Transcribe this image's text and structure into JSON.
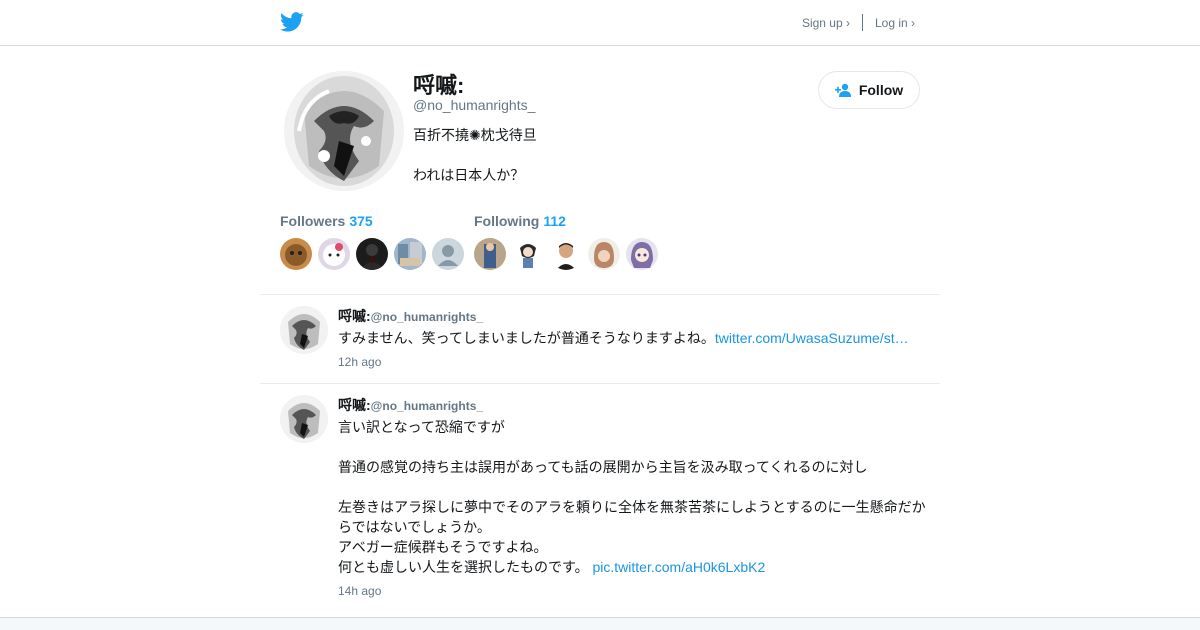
{
  "header": {
    "sign_up_label": "Sign up ›",
    "log_in_label": "Log in ›"
  },
  "profile": {
    "name": "哷嘁:",
    "handle": "@no_humanrights_",
    "bio": "百折不撓✺枕戈待旦\n\nわれは日本人か？",
    "follow_label": "Follow",
    "followers_label": "Followers",
    "followers_count": "375",
    "following_label": "Following",
    "following_count": "112"
  },
  "tweets": [
    {
      "name": "哷嘁:",
      "handle": "@no_humanrights_",
      "text": "すみません、笑ってしまいましたが普通そうなりますよね。",
      "link": "twitter.com/UwasaSuzume/st…",
      "time": "12h ago"
    },
    {
      "name": "哷嘁:",
      "handle": "@no_humanrights_",
      "text": "言い訳となって恐縮ですが\n\n普通の感覚の持ち主は誤用があっても話の展開から主旨を汲み取ってくれるのに対し\n\n左巻きはアラ探しに夢中でそのアラを頼りに全体を無茶苦茶にしようとするのに一生懸命だか\nらではないでしょうか。\nアベガー症候群もそうですよね。\n何とも虚しい人生を選択したものです。 ",
      "link": "pic.twitter.com/aH0k6LxbK2",
      "time": "14h ago"
    }
  ],
  "colors": {
    "brand_blue": "#1da1f2",
    "link_blue": "#1b95e0",
    "muted_gray": "#657786"
  }
}
